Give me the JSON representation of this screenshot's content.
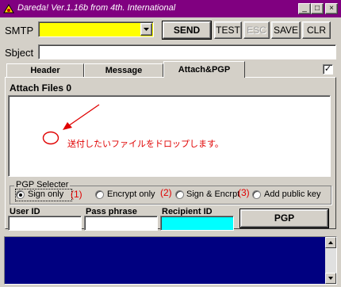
{
  "window": {
    "title": "Dareda! Ver.1.16b from 4th. International",
    "minimize": "_",
    "maximize": "□",
    "close": "×"
  },
  "toolbar": {
    "smtp_label": "SMTP",
    "smtp_value": "",
    "send_label": "SEND",
    "test_label": "TEST",
    "esc_label": "ESC",
    "save_label": "SAVE",
    "clr_label": "CLR"
  },
  "subject": {
    "label": "Sbject",
    "value": ""
  },
  "tabs": [
    {
      "label": "Header"
    },
    {
      "label": "Message"
    },
    {
      "label": "Attach&PGP",
      "active": true
    }
  ],
  "tab_checkbox_mark": "✓",
  "attach": {
    "heading": "Attach Files 0",
    "annotation_text": "送付したいファイルをドロップします。"
  },
  "pgp": {
    "group_label": "PGP Selecter",
    "options": [
      {
        "label": "Sign only",
        "selected": true,
        "note": "(1)"
      },
      {
        "label": "Encrypt only",
        "selected": false,
        "note": "(2)"
      },
      {
        "label": "Sign & Encrpt",
        "selected": false,
        "note": "(3)"
      },
      {
        "label": "Add public key",
        "selected": false
      }
    ],
    "user_id_label": "User ID",
    "user_id_value": "",
    "pass_phrase_label": "Pass phrase",
    "pass_phrase_value": "",
    "recipient_id_label": "Recipient ID",
    "recipient_id_value": "",
    "pgp_button": "PGP"
  },
  "colors": {
    "titlebar": "#800080",
    "smtp_field": "#ffff00",
    "recipient_field": "#00ffff",
    "log_area": "#000080",
    "annotation": "#e00000"
  },
  "icons": {
    "app": "app-icon",
    "dropdown": "chevron-down-icon",
    "scroll_up": "scroll-up-icon",
    "scroll_down": "scroll-down-icon"
  }
}
